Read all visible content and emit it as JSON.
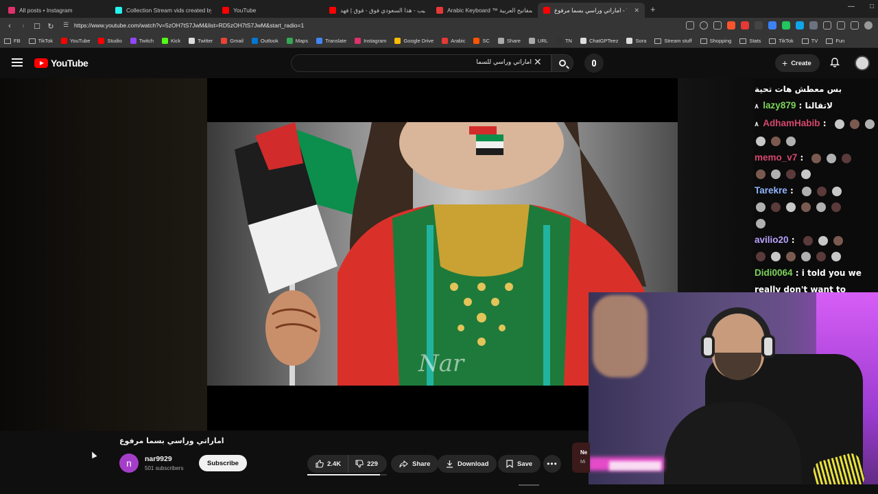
{
  "browser": {
    "tabs": [
      {
        "title": "All posts • Instagram",
        "color": "#e1306c",
        "active": false
      },
      {
        "title": "Collection Stream vids created by ka",
        "color": "#25f4ee",
        "active": false
      },
      {
        "title": "YouTube",
        "color": "#ff0000",
        "active": false
      },
      {
        "title": "كليب - هذا السعودي فوق - فوق | فهد",
        "color": "#ff0000",
        "active": false
      },
      {
        "title": "Arabic Keyboard ™ لوحة المفاتيح العربية",
        "color": "#e53935",
        "active": false
      },
      {
        "title": "اماراتي وراسي بسما مرفوع - Yo",
        "color": "#ff0000",
        "active": true
      }
    ],
    "url": "https://www.youtube.com/watch?v=5zOH7tS7JwM&list=RD5zOH7tS7JwM&start_radio=1",
    "bookmarks": [
      {
        "label": "FB",
        "kind": "folder",
        "color": ""
      },
      {
        "label": "TikTok",
        "kind": "folder",
        "color": ""
      },
      {
        "label": "YouTube",
        "kind": "site",
        "color": "#ff0000"
      },
      {
        "label": "Studio",
        "kind": "site",
        "color": "#ff0000"
      },
      {
        "label": "Twitch",
        "kind": "site",
        "color": "#9146ff"
      },
      {
        "label": "Kick",
        "kind": "site",
        "color": "#53fc18"
      },
      {
        "label": "Twitter",
        "kind": "site",
        "color": "#dddddd"
      },
      {
        "label": "Gmail",
        "kind": "site",
        "color": "#ea4335"
      },
      {
        "label": "Outlook",
        "kind": "site",
        "color": "#0078d4"
      },
      {
        "label": "Maps",
        "kind": "site",
        "color": "#34a853"
      },
      {
        "label": "Translate",
        "kind": "site",
        "color": "#4285f4"
      },
      {
        "label": "Instagram",
        "kind": "site",
        "color": "#e1306c"
      },
      {
        "label": "Google Drive",
        "kind": "site",
        "color": "#fbbc04"
      },
      {
        "label": "Arabic",
        "kind": "site",
        "color": "#e53935"
      },
      {
        "label": "SC",
        "kind": "site",
        "color": "#ff5500"
      },
      {
        "label": "Share",
        "kind": "site",
        "color": "#aaaaaa"
      },
      {
        "label": "URL",
        "kind": "site",
        "color": "#aaaaaa"
      },
      {
        "label": "TN",
        "kind": "site",
        "color": "#333333"
      },
      {
        "label": "ChatGPTeez",
        "kind": "site",
        "color": "#dddddd"
      },
      {
        "label": "Sora",
        "kind": "site",
        "color": "#dddddd"
      },
      {
        "label": "Stream stuff",
        "kind": "folder",
        "color": ""
      },
      {
        "label": "Shopping",
        "kind": "folder",
        "color": ""
      },
      {
        "label": "Stats",
        "kind": "folder",
        "color": ""
      },
      {
        "label": "TikTok",
        "kind": "folder",
        "color": ""
      },
      {
        "label": "TV",
        "kind": "folder",
        "color": ""
      },
      {
        "label": "Fun",
        "kind": "folder",
        "color": ""
      }
    ]
  },
  "youtube": {
    "logo_text": "YouTube",
    "search_value": "اماراتي وراسي للسما",
    "create_label": "Create",
    "video": {
      "title": "اماراتي وراسي بسما مرفوع",
      "watermark": "Nar"
    },
    "channel": {
      "initial": "n",
      "name": "nar9929",
      "subscribers": "501 subscribers",
      "subscribe_label": "Subscribe"
    },
    "actions": {
      "likes": "2.4K",
      "like_ratio": 0.91,
      "dislikes": "229",
      "share_label": "Share",
      "download_label": "Download",
      "save_label": "Save"
    },
    "next_card": {
      "line1": "Ne",
      "line2": "Mi"
    }
  },
  "chat": {
    "header_message": "بس معطش هات تحية",
    "messages": [
      {
        "user": "lazy879",
        "color": "#7cd65a",
        "text": "لاتقالنا",
        "badge": "٨",
        "emotes": 0
      },
      {
        "user": "AdhamHabib",
        "color": "#d6476d",
        "text": "",
        "badge": "٨",
        "emotes": 6
      },
      {
        "user": "memo_v7",
        "color": "#d6476d",
        "text": "",
        "badge": "",
        "emotes": 7
      },
      {
        "user": "Tarekre",
        "color": "#8fb4ff",
        "text": "",
        "badge": "",
        "emotes": 10
      },
      {
        "user": "avilio20",
        "color": "#b9a3ff",
        "text": "",
        "badge": "",
        "emotes": 9
      },
      {
        "user": "Didi0064",
        "color": "#7cd65a",
        "text": "i told you we",
        "badge": "",
        "emotes": 0
      }
    ],
    "continuation": "really don't want to"
  },
  "colors": {
    "youtube_red": "#ff0000",
    "background": "#0f0f0f",
    "pill": "#272727"
  }
}
